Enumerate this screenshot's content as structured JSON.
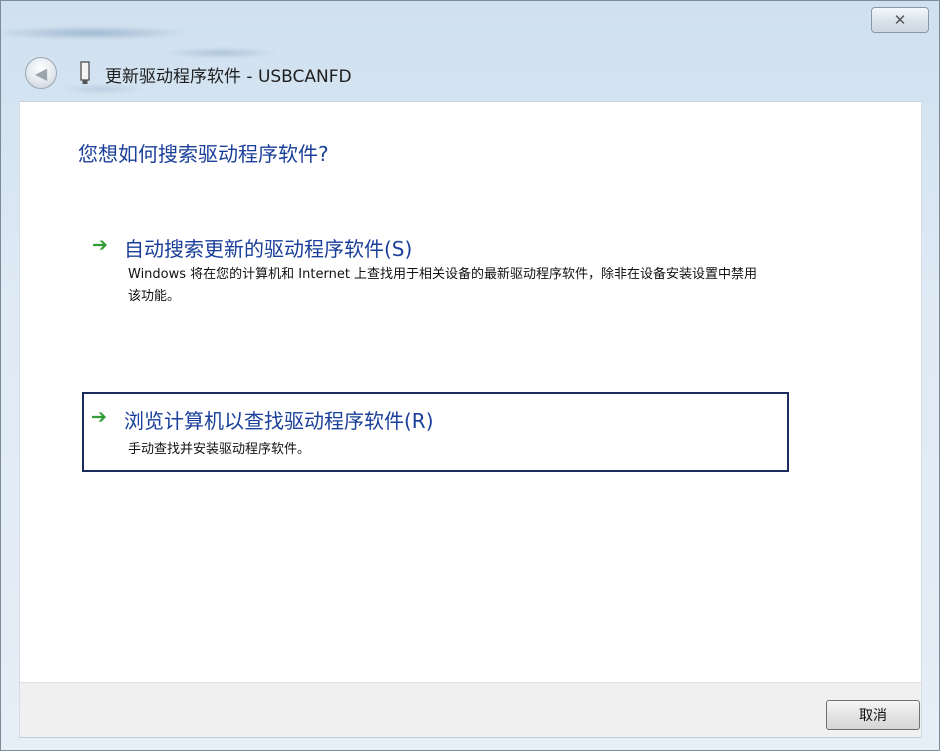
{
  "window": {
    "title": "更新驱动程序软件 - USBCANFD",
    "close_glyph": "✕"
  },
  "nav": {
    "back_glyph": "◀"
  },
  "main": {
    "heading": "您想如何搜索驱动程序软件?",
    "options": [
      {
        "title": "自动搜索更新的驱动程序软件(S)",
        "description": "Windows 将在您的计算机和 Internet 上查找用于相关设备的最新驱动程序软件，除非在设备安装设置中禁用该功能。"
      },
      {
        "title": "浏览计算机以查找驱动程序软件(R)",
        "description": "手动查找并安装驱动程序软件。"
      }
    ]
  },
  "footer": {
    "cancel_label": "取消"
  },
  "icons": {
    "arrow": "arrow-right-icon",
    "device": "usb-device-icon",
    "back": "back-arrow-icon",
    "close": "close-icon"
  },
  "colors": {
    "link_blue": "#1a3f9a",
    "arrow_green": "#2f9d33",
    "focus_border": "#1b2b5c"
  }
}
